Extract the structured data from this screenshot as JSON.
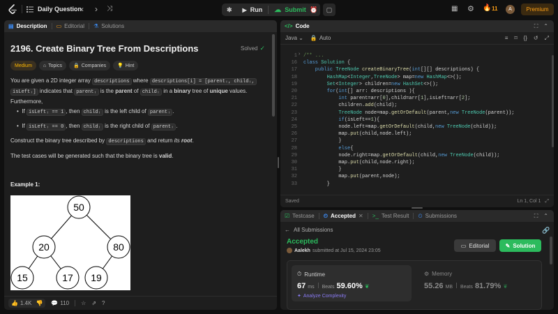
{
  "topbar": {
    "problem_list_label": "Daily Question",
    "run_label": "Run",
    "submit_label": "Submit",
    "streak_count": "11",
    "premium_label": "Premium"
  },
  "left_panel": {
    "tabs": [
      {
        "label": "Description"
      },
      {
        "label": "Editorial"
      },
      {
        "label": "Solutions"
      }
    ],
    "title": "2196. Create Binary Tree From Descriptions",
    "solved_label": "Solved",
    "badges": {
      "difficulty": "Medium",
      "topics": "Topics",
      "companies": "Companies",
      "hint": "Hint"
    },
    "intro_a": "You are given a 2D integer array",
    "code_descriptions": "descriptions",
    "intro_b": "where",
    "code_desc_i": "descriptions[i] = [parentᵢ, childᵢ,",
    "code_isleft_i": "isLeftᵢ]",
    "intro_c": "indicates that",
    "code_parent_i": "parentᵢ",
    "intro_d": "is the",
    "bold_parent": "parent",
    "intro_e": "of",
    "code_child_i": "childᵢ",
    "intro_f": "in a",
    "bold_binary": "binary",
    "intro_g": "tree of",
    "bold_unique": "unique",
    "intro_h": "values.",
    "intro_furthermore": "Furthermore,",
    "bullet1_a": "If",
    "bullet1_code": "isLeftᵢ == 1",
    "bullet1_b": ", then",
    "bullet1_code2": "childᵢ",
    "bullet1_c": "is the left child of",
    "bullet1_code3": "parentᵢ",
    "bullet1_d": ".",
    "bullet2_a": "If",
    "bullet2_code": "isLeftᵢ == 0",
    "bullet2_b": ", then",
    "bullet2_code2": "childᵢ",
    "bullet2_c": "is the right child of",
    "bullet2_code3": "parentᵢ",
    "bullet2_d": ".",
    "construct_a": "Construct the binary tree described by",
    "construct_code": "descriptions",
    "construct_b": "and return",
    "construct_its": "its",
    "construct_root": "root",
    "construct_c": ".",
    "valid_a": "The test cases will be generated such that the binary tree is",
    "valid_b": "valid",
    "valid_c": ".",
    "example_label": "Example 1:",
    "tree_nodes": [
      "50",
      "20",
      "80",
      "15",
      "17",
      "19"
    ],
    "footer": {
      "likes": "1.4K",
      "comments": "110"
    }
  },
  "code_panel": {
    "tab_label": "Code",
    "language": "Java",
    "auto_label": "Auto",
    "saved_label": "Saved",
    "cursor_pos": "Ln 1, Col 1",
    "line_numbers": [
      "1",
      "16",
      "17",
      "18",
      "19",
      "20",
      "21",
      "22",
      "23",
      "24",
      "25",
      "26",
      "27",
      "28",
      "29",
      "30",
      "31",
      "32",
      "33"
    ],
    "lines": [
      [
        {
          "t": "/**",
          "c": "cm"
        },
        {
          "t": " ...",
          "c": "cm"
        }
      ],
      [
        {
          "t": "class ",
          "c": "kw"
        },
        {
          "t": "Solution ",
          "c": "ty"
        },
        {
          "t": "{",
          "c": "pl"
        }
      ],
      [
        {
          "t": "    public ",
          "c": "kw"
        },
        {
          "t": "TreeNode ",
          "c": "ty"
        },
        {
          "t": "createBinaryTree",
          "c": "fn"
        },
        {
          "t": "(",
          "c": "pl"
        },
        {
          "t": "int",
          "c": "kw"
        },
        {
          "t": "[][] descriptions) {",
          "c": "pl"
        }
      ],
      [
        {
          "t": "        HashMap",
          "c": "ty"
        },
        {
          "t": "<",
          "c": "pl"
        },
        {
          "t": "Integer",
          "c": "ty"
        },
        {
          "t": ",",
          "c": "pl"
        },
        {
          "t": "TreeNode",
          "c": "ty"
        },
        {
          "t": "> map=",
          "c": "pl"
        },
        {
          "t": "new ",
          "c": "kw"
        },
        {
          "t": "HashMap",
          "c": "ty"
        },
        {
          "t": "<>();",
          "c": "pl"
        }
      ],
      [
        {
          "t": "        Set",
          "c": "ty"
        },
        {
          "t": "<",
          "c": "pl"
        },
        {
          "t": "Integer",
          "c": "ty"
        },
        {
          "t": "> children=",
          "c": "pl"
        },
        {
          "t": "new ",
          "c": "kw"
        },
        {
          "t": "HashSet",
          "c": "ty"
        },
        {
          "t": "<>();",
          "c": "pl"
        }
      ],
      [
        {
          "t": "        for",
          "c": "kw"
        },
        {
          "t": "(",
          "c": "pl"
        },
        {
          "t": "int",
          "c": "kw"
        },
        {
          "t": "[] arr: descriptions ){",
          "c": "pl"
        }
      ],
      [
        {
          "t": "            int ",
          "c": "kw"
        },
        {
          "t": "parent=arr[",
          "c": "pl"
        },
        {
          "t": "0",
          "c": "nm"
        },
        {
          "t": "],child=arr[",
          "c": "pl"
        },
        {
          "t": "1",
          "c": "nm"
        },
        {
          "t": "],isLeft=arr[",
          "c": "pl"
        },
        {
          "t": "2",
          "c": "nm"
        },
        {
          "t": "];",
          "c": "pl"
        }
      ],
      [
        {
          "t": "            children.",
          "c": "pl"
        },
        {
          "t": "add",
          "c": "fn"
        },
        {
          "t": "(child);",
          "c": "pl"
        }
      ],
      [
        {
          "t": "            TreeNode ",
          "c": "ty"
        },
        {
          "t": "node=map.",
          "c": "pl"
        },
        {
          "t": "getOrDefault",
          "c": "fn"
        },
        {
          "t": "(parent,",
          "c": "pl"
        },
        {
          "t": "new ",
          "c": "kw"
        },
        {
          "t": "TreeNode",
          "c": "ty"
        },
        {
          "t": "(parent));",
          "c": "pl"
        }
      ],
      [
        {
          "t": "            if",
          "c": "kw"
        },
        {
          "t": "(isLeft==",
          "c": "pl"
        },
        {
          "t": "1",
          "c": "nm"
        },
        {
          "t": "){",
          "c": "pl"
        }
      ],
      [
        {
          "t": "            node.left=map.",
          "c": "pl"
        },
        {
          "t": "getOrDefault",
          "c": "fn"
        },
        {
          "t": "(child,",
          "c": "pl"
        },
        {
          "t": "new ",
          "c": "kw"
        },
        {
          "t": "TreeNode",
          "c": "ty"
        },
        {
          "t": "(child));",
          "c": "pl"
        }
      ],
      [
        {
          "t": "            map.",
          "c": "pl"
        },
        {
          "t": "put",
          "c": "fn"
        },
        {
          "t": "(child,node.left);",
          "c": "pl"
        }
      ],
      [
        {
          "t": "            }",
          "c": "pl"
        }
      ],
      [
        {
          "t": "            else",
          "c": "kw"
        },
        {
          "t": "{",
          "c": "pl"
        }
      ],
      [
        {
          "t": "            node.right=map.",
          "c": "pl"
        },
        {
          "t": "getOrDefault",
          "c": "fn"
        },
        {
          "t": "(child,",
          "c": "pl"
        },
        {
          "t": "new ",
          "c": "kw"
        },
        {
          "t": "TreeNode",
          "c": "ty"
        },
        {
          "t": "(child));",
          "c": "pl"
        }
      ],
      [
        {
          "t": "            map.",
          "c": "pl"
        },
        {
          "t": "put",
          "c": "fn"
        },
        {
          "t": "(child,node.right);",
          "c": "pl"
        }
      ],
      [
        {
          "t": "            }",
          "c": "pl"
        }
      ],
      [
        {
          "t": "            map.",
          "c": "pl"
        },
        {
          "t": "put",
          "c": "fn"
        },
        {
          "t": "(parent,node);",
          "c": "pl"
        }
      ],
      [
        {
          "t": "        }",
          "c": "pl"
        }
      ]
    ]
  },
  "result_panel": {
    "tabs": [
      {
        "label": "Testcase"
      },
      {
        "label": "Accepted"
      },
      {
        "label": "Test Result"
      },
      {
        "label": "Submissions"
      }
    ],
    "all_submissions": "All Submissions",
    "status": "Accepted",
    "user": "Aalekh",
    "submitted_at": "submitted at Jul 15, 2024 23:05",
    "editorial_btn": "Editorial",
    "solution_btn": "Solution",
    "runtime_label": "Runtime",
    "runtime_value": "67",
    "runtime_unit": "ms",
    "beats_label": "Beats",
    "runtime_beats": "59.60%",
    "analyze_label": "Analyze Complexity",
    "memory_label": "Memory",
    "memory_value": "55.26",
    "memory_unit": "MB",
    "memory_beats": "81.79%"
  },
  "colors": {
    "accent_orange": "#ffa116",
    "green": "#2cbb5d",
    "blue_link": "#3c8cf4"
  }
}
